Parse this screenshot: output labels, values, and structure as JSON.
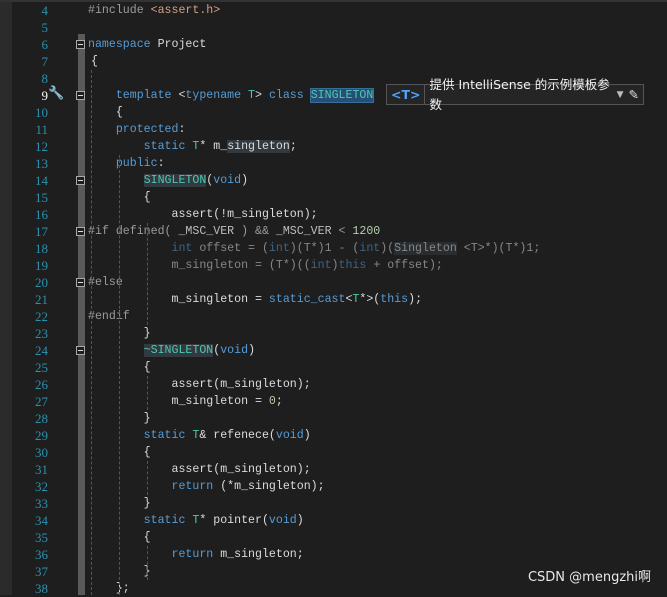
{
  "editor": {
    "current_line": 9,
    "folded_lines": [
      6,
      9,
      14,
      17,
      20,
      24
    ],
    "lines": [
      {
        "n": 4,
        "i": 0,
        "tk": [
          [
            "p",
            "#include "
          ],
          [
            "s",
            "<assert.h>"
          ]
        ]
      },
      {
        "n": 5,
        "i": 0,
        "tk": []
      },
      {
        "n": 6,
        "i": 0,
        "tk": [
          [
            "k",
            "namespace"
          ],
          [
            "x",
            " Project"
          ]
        ]
      },
      {
        "n": 7,
        "i": 0,
        "tk": [
          [
            "x",
            "{"
          ]
        ]
      },
      {
        "n": 8,
        "i": 0,
        "tk": []
      },
      {
        "n": 9,
        "i": 4,
        "tk": [
          [
            "k",
            "template"
          ],
          [
            "x",
            " <"
          ],
          [
            "k",
            "typename"
          ],
          [
            "t",
            " T"
          ],
          [
            "x",
            "> "
          ],
          [
            "k",
            "class"
          ],
          [
            "x",
            " "
          ],
          [
            "t hl",
            "SINGLETON"
          ]
        ]
      },
      {
        "n": 10,
        "i": 4,
        "tk": [
          [
            "x",
            "{"
          ]
        ]
      },
      {
        "n": 11,
        "i": 4,
        "tk": [
          [
            "k",
            "protected"
          ],
          [
            "x",
            ":"
          ]
        ]
      },
      {
        "n": 12,
        "i": 8,
        "tk": [
          [
            "k",
            "static"
          ],
          [
            "t",
            " T"
          ],
          [
            "x",
            "* m_"
          ],
          [
            "x ref",
            "singleton"
          ],
          [
            "x",
            ";"
          ]
        ]
      },
      {
        "n": 13,
        "i": 4,
        "tk": [
          [
            "k",
            "public"
          ],
          [
            "x",
            ":"
          ]
        ]
      },
      {
        "n": 14,
        "i": 8,
        "tk": [
          [
            "t ref",
            "SINGLETON"
          ],
          [
            "x",
            "("
          ],
          [
            "k",
            "void"
          ],
          [
            "x",
            ")"
          ]
        ]
      },
      {
        "n": 15,
        "i": 8,
        "tk": [
          [
            "x",
            "{"
          ]
        ]
      },
      {
        "n": 16,
        "i": 12,
        "tk": [
          [
            "x",
            "assert(!m_singleton);"
          ]
        ]
      },
      {
        "n": 17,
        "i": 0,
        "tk": [
          [
            "p",
            "#if defined( "
          ],
          [
            "m",
            "_MSC_VER"
          ],
          [
            "p",
            " ) && "
          ],
          [
            "m",
            "_MSC_VER"
          ],
          [
            "p",
            " < "
          ],
          [
            "n",
            "1200"
          ]
        ]
      },
      {
        "n": 18,
        "i": 12,
        "d": true,
        "tk": [
          [
            "k",
            "int"
          ],
          [
            "x",
            " offset = ("
          ],
          [
            "k",
            "int"
          ],
          [
            "x",
            ")(T*)1 - ("
          ],
          [
            "k",
            "int"
          ],
          [
            "x",
            ")("
          ],
          [
            "x ref",
            "Singleton"
          ],
          [
            "x",
            " <T>*)(T*)1;"
          ]
        ]
      },
      {
        "n": 19,
        "i": 12,
        "d": true,
        "tk": [
          [
            "x",
            "m_singleton = (T*)(("
          ],
          [
            "k",
            "int"
          ],
          [
            "x",
            ")"
          ],
          [
            "k",
            "this"
          ],
          [
            "x",
            " + offset);"
          ]
        ]
      },
      {
        "n": 20,
        "i": 0,
        "tk": [
          [
            "p",
            "#else"
          ]
        ]
      },
      {
        "n": 21,
        "i": 12,
        "tk": [
          [
            "x",
            "m_singleton = "
          ],
          [
            "k",
            "static_cast"
          ],
          [
            "x",
            "<"
          ],
          [
            "t",
            "T"
          ],
          [
            "x",
            "*>("
          ],
          [
            "k",
            "this"
          ],
          [
            "x",
            ");"
          ]
        ]
      },
      {
        "n": 22,
        "i": 0,
        "tk": [
          [
            "p",
            "#endif"
          ]
        ]
      },
      {
        "n": 23,
        "i": 8,
        "tk": [
          [
            "x",
            "}"
          ]
        ]
      },
      {
        "n": 24,
        "i": 8,
        "tk": [
          [
            "t ref",
            "~SINGLETON"
          ],
          [
            "x",
            "("
          ],
          [
            "k",
            "void"
          ],
          [
            "x",
            ")"
          ]
        ]
      },
      {
        "n": 25,
        "i": 8,
        "tk": [
          [
            "x",
            "{"
          ]
        ]
      },
      {
        "n": 26,
        "i": 12,
        "tk": [
          [
            "x",
            "assert(m_singleton);"
          ]
        ]
      },
      {
        "n": 27,
        "i": 12,
        "tk": [
          [
            "x",
            "m_singleton = "
          ],
          [
            "n",
            "0"
          ],
          [
            "x",
            ";"
          ]
        ]
      },
      {
        "n": 28,
        "i": 8,
        "tk": [
          [
            "x",
            "}"
          ]
        ]
      },
      {
        "n": 29,
        "i": 8,
        "tk": [
          [
            "k",
            "static"
          ],
          [
            "t",
            " T"
          ],
          [
            "x",
            "& refenece("
          ],
          [
            "k",
            "void"
          ],
          [
            "x",
            ")"
          ]
        ]
      },
      {
        "n": 30,
        "i": 8,
        "tk": [
          [
            "x",
            "{"
          ]
        ]
      },
      {
        "n": 31,
        "i": 12,
        "tk": [
          [
            "x",
            "assert(m_singleton);"
          ]
        ]
      },
      {
        "n": 32,
        "i": 12,
        "tk": [
          [
            "k",
            "return"
          ],
          [
            "x",
            " (*m_singleton);"
          ]
        ]
      },
      {
        "n": 33,
        "i": 8,
        "tk": [
          [
            "x",
            "}"
          ]
        ]
      },
      {
        "n": 34,
        "i": 8,
        "tk": [
          [
            "k",
            "static"
          ],
          [
            "t",
            " T"
          ],
          [
            "x",
            "* pointer("
          ],
          [
            "k",
            "void"
          ],
          [
            "x",
            ")"
          ]
        ]
      },
      {
        "n": 35,
        "i": 8,
        "tk": [
          [
            "x",
            "{"
          ]
        ]
      },
      {
        "n": 36,
        "i": 12,
        "tk": [
          [
            "k",
            "return"
          ],
          [
            "x",
            " m_singleton;"
          ]
        ]
      },
      {
        "n": 37,
        "i": 8,
        "tk": [
          [
            "x",
            "}"
          ]
        ]
      },
      {
        "n": 38,
        "i": 4,
        "tk": [
          [
            "x",
            "};"
          ]
        ]
      }
    ]
  },
  "hint": {
    "tag": "<T>",
    "label": "提供 IntelliSense 的示例模板参数",
    "dropdown_icon": "caret-down-icon",
    "edit_icon": "pencil-icon"
  },
  "quick_action_icon": "screwdriver-icon",
  "watermark": "CSDN @mengzhi啊"
}
